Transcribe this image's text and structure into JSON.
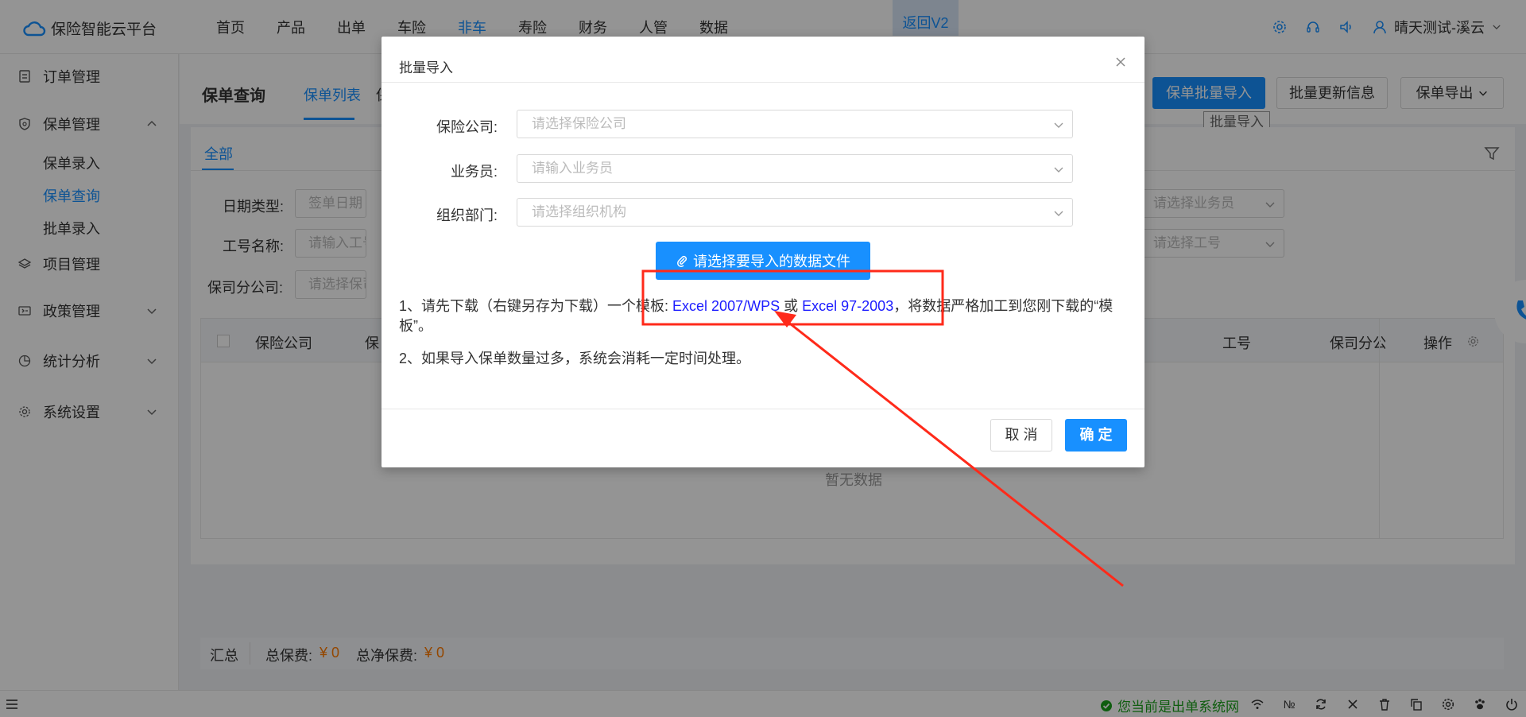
{
  "app": {
    "title": "保险智能云平台",
    "return_label": "返回V2",
    "user_name": "晴天测试-溪云"
  },
  "nav": {
    "items": [
      {
        "label": "首页"
      },
      {
        "label": "产品"
      },
      {
        "label": "出单"
      },
      {
        "label": "车险"
      },
      {
        "label": "非车",
        "active": true
      },
      {
        "label": "寿险"
      },
      {
        "label": "财务"
      },
      {
        "label": "人管"
      },
      {
        "label": "数据"
      }
    ]
  },
  "sidebar": {
    "items": [
      {
        "label": "订单管理",
        "icon": "order-icon"
      },
      {
        "label": "保单管理",
        "icon": "policy-icon",
        "expanded": true,
        "children": [
          {
            "label": "保单录入"
          },
          {
            "label": "保单查询",
            "active": true
          },
          {
            "label": "批单录入"
          }
        ]
      },
      {
        "label": "项目管理",
        "icon": "layers-icon"
      },
      {
        "label": "政策管理",
        "icon": "ticket-icon"
      },
      {
        "label": "统计分析",
        "icon": "pie-chart-icon"
      },
      {
        "label": "系统设置",
        "icon": "gear-icon"
      }
    ]
  },
  "page": {
    "title": "保单查询",
    "tabs": [
      {
        "label": "保单列表",
        "active": true
      },
      {
        "label": "保"
      }
    ],
    "buttons": {
      "batch_import": "保单批量导入",
      "batch_update": "批量更新信息",
      "export": "保单导出"
    },
    "tooltip": "批量导入"
  },
  "card": {
    "tab_all": "全部",
    "filters": {
      "date_type_label": "日期类型:",
      "date_type_value": "签单日期",
      "job_name_label": "工号名称:",
      "job_name_placeholder": "请输入工号名称",
      "branch_label": "保司分公司:",
      "branch_placeholder": "请选择保司分公司",
      "salesman_placeholder": "请选择业务员",
      "job_no_placeholder": "请选择工号"
    },
    "table": {
      "columns": [
        "保险公司",
        "保",
        "工号",
        "保司分公",
        "操作"
      ],
      "empty_text": "暂无数据"
    },
    "summary": {
      "label": "汇总",
      "total_premium_label": "总保费:",
      "total_premium_value": "¥ 0",
      "net_premium_label": "总净保费:",
      "net_premium_value": "¥ 0"
    }
  },
  "modal": {
    "title": "批量导入",
    "fields": {
      "company_label": "保险公司:",
      "company_placeholder": "请选择保险公司",
      "salesman_label": "业务员:",
      "salesman_placeholder": "请输入业务员",
      "org_label": "组织部门:",
      "org_placeholder": "请选择组织机构"
    },
    "upload_label": "请选择要导入的数据文件",
    "note1_prefix": "1、请先下载（右键另存为下载）一个模板:",
    "note1_link1": "Excel 2007/WPS",
    "note1_or": "或",
    "note1_link2": "Excel 97-2003",
    "note1_suffix": "，将数据严格加工到您刚下载的“模板”。",
    "note2": "2、如果导入保单数量过多，系统会消耗一定时间处理。",
    "cancel_label": "取 消",
    "ok_label": "确 定"
  },
  "statusbar": {
    "status_text": "您当前是出单系统网",
    "icons": [
      "wifi-icon",
      "numero-icon",
      "refresh-icon",
      "close-icon",
      "trash-icon",
      "copy-icon",
      "gear-icon",
      "paw-icon",
      "power-icon"
    ]
  },
  "annotation_color": "#ff2a1a",
  "accent_color": "#1890ff"
}
